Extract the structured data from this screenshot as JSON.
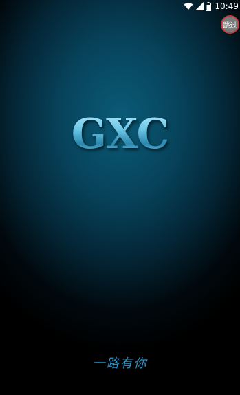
{
  "status_bar": {
    "time": "10:49",
    "wifi_icon": "wifi-icon",
    "signal_icon": "signal-icon",
    "battery_icon": "battery-icon"
  },
  "skip_button": {
    "label": "跳过",
    "border_color": "#c43a3a"
  },
  "splash": {
    "logo_text": "GXC",
    "slogan": "一路有你"
  },
  "colors": {
    "background_center": "#0a5b78",
    "background_edge": "#000000",
    "logo": "#5fb8d8",
    "slogan": "#2a95c9"
  }
}
